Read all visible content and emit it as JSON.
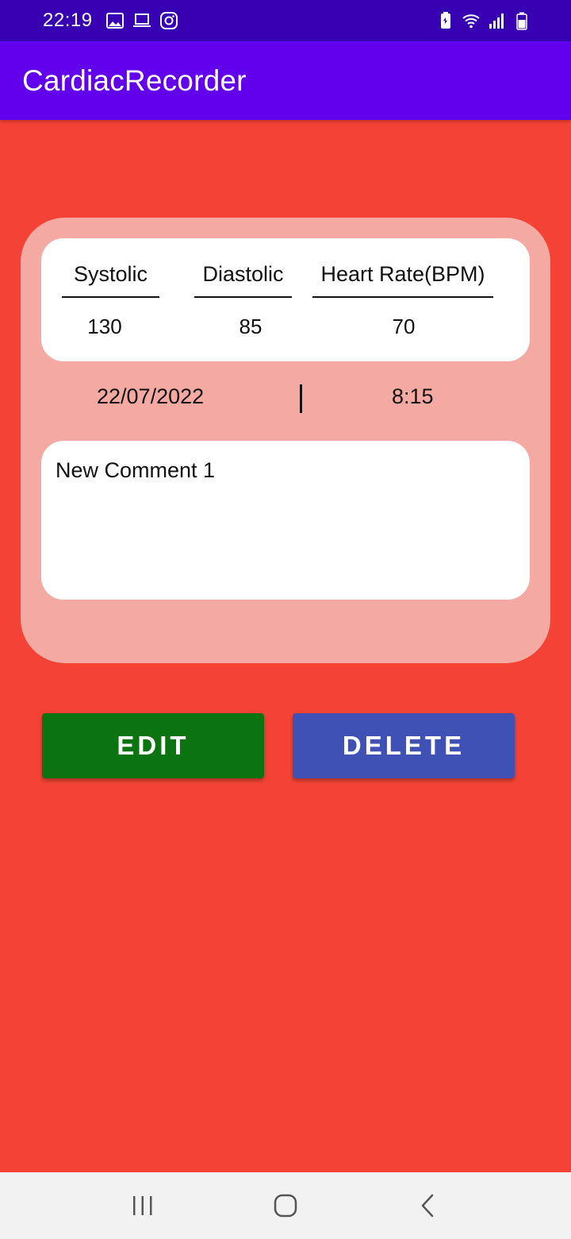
{
  "status_bar": {
    "time": "22:19",
    "left_icons": [
      "image-icon",
      "laptop-icon",
      "instagram-icon"
    ],
    "right_icons": [
      "battery-saver-icon",
      "wifi-icon",
      "signal-icon",
      "battery-icon"
    ]
  },
  "app_bar": {
    "title": "CardiacRecorder"
  },
  "readings": {
    "systolic_label": "Systolic",
    "diastolic_label": "Diastolic",
    "heart_rate_label": "Heart Rate(BPM)",
    "systolic_value": "130",
    "diastolic_value": "85",
    "heart_rate_value": "70"
  },
  "datetime": {
    "date": "22/07/2022",
    "time": "8:15"
  },
  "comment": "New Comment 1",
  "buttons": {
    "edit": "EDIT",
    "delete": "DELETE"
  },
  "colors": {
    "status_bar": "#3700b3",
    "app_bar": "#6200ee",
    "background": "#f44336",
    "card": "#f4a9a3",
    "edit_button": "#0b7411",
    "delete_button": "#3f51b5"
  },
  "nav_bar": {
    "icons": [
      "recent-apps-icon",
      "home-icon",
      "back-icon"
    ]
  }
}
